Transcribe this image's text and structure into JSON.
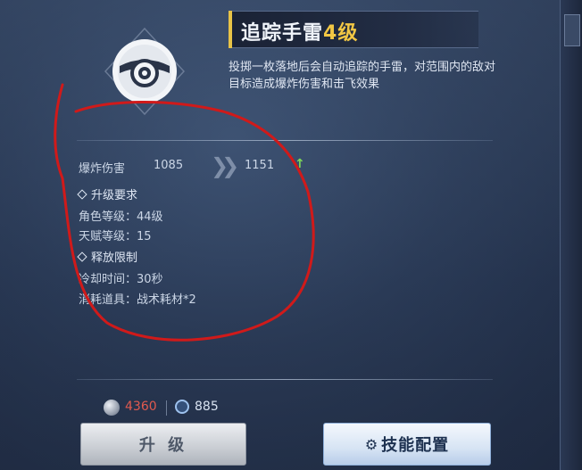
{
  "skill": {
    "title": "追踪手雷",
    "level": "4级",
    "description": "投掷一枚落地后会自动追踪的手雷，对范围内的敌对目标造成爆炸伤害和击飞效果"
  },
  "stat": {
    "label": "爆炸伤害",
    "current": "1085",
    "next": "1151"
  },
  "requirements": {
    "heading": "升级要求",
    "role_level": "角色等级：44级",
    "talent_level": "天赋等级：15"
  },
  "limits": {
    "heading": "释放限制",
    "cooldown": "冷却时间：30秒",
    "consume": "消耗道具：战术耗材*2"
  },
  "currency": {
    "coins": "4360",
    "gems": "885"
  },
  "buttons": {
    "upgrade": "升 级",
    "config": "技能配置"
  },
  "icons": {
    "skill": "grenade-icon",
    "coin": "coin-icon",
    "gem": "gem-icon",
    "gear": "gear-icon",
    "arrow": "double-chevron-right-icon",
    "up": "arrow-up-icon"
  },
  "colors": {
    "level_accent": "#f2c744",
    "coin_insufficient": "#e05a4f",
    "upgrade_green": "#7ed957",
    "annotation_red": "#d01a1a"
  }
}
